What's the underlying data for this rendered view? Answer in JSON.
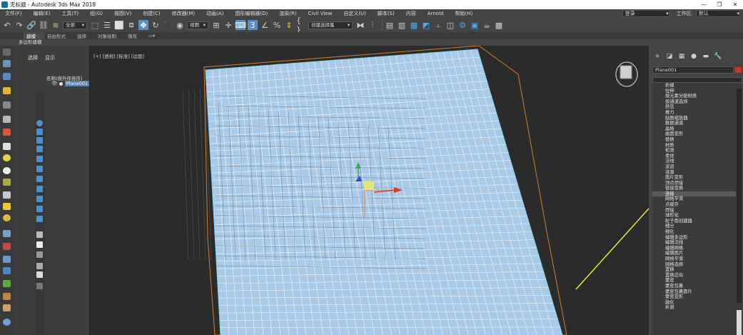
{
  "window": {
    "title": "无标题 - Autodesk 3ds Max 2018",
    "controls": [
      "—",
      "❐",
      "✕"
    ]
  },
  "menu": {
    "items": [
      "文件(F)",
      "编辑(E)",
      "工具(T)",
      "组(G)",
      "视图(V)",
      "创建(C)",
      "修改器(M)",
      "动画(A)",
      "图形编辑器(D)",
      "渲染(R)",
      "Civil View",
      "自定义(U)",
      "脚本(S)",
      "内容",
      "Arnold",
      "帮助(H)"
    ],
    "login": "登录",
    "workspace_label": "工作区:",
    "workspace_value": "默认"
  },
  "toolbar": {
    "selection_filter": "全部",
    "ref_coord": "视图",
    "named_selection": "创建选择集"
  },
  "ribbon": {
    "tabs": [
      "建模",
      "自由形式",
      "选择",
      "对象绘制",
      "填充"
    ],
    "sub_label": "多边形建模"
  },
  "scene_explorer": {
    "tabs": [
      "选择",
      "显示"
    ],
    "header": "名称(按升序排序)",
    "object_name": "Plane001"
  },
  "viewport": {
    "label": "[+] [透视] [标准] [边面]",
    "plane_color": "#a9c9e8",
    "wire_color": "#ffffff",
    "annotation_color": "#f2f23a"
  },
  "command_panel": {
    "object_name": "Plane001",
    "object_color": "#c0392b",
    "highlighted_index": 20,
    "modifiers": [
      "折缝",
      "拉伸",
      "按元素分配材质",
      "按通道选择",
      "挤压",
      "推力",
      "贴图缩放器",
      "数据通道",
      "晶格",
      "曲面变形",
      "替换",
      "材质",
      "松弛",
      "柔体",
      "法线",
      "波浪",
      "涟漪",
      "面片变形",
      "顶点焊接",
      "链接变换",
      "连接",
      "网格平滑",
      "点缓存",
      "焊接",
      "球形化",
      "粒子面创建器",
      "细分",
      "细化",
      "编辑多边形",
      "编辑法线",
      "编辑网格",
      "编辑面片",
      "网格平滑",
      "网格选择",
      "置换",
      "置换近似",
      "蒙皮",
      "蒙皮包裹",
      "蒙皮包裹面片",
      "蒙皮变形",
      "融化",
      "补洞"
    ]
  }
}
